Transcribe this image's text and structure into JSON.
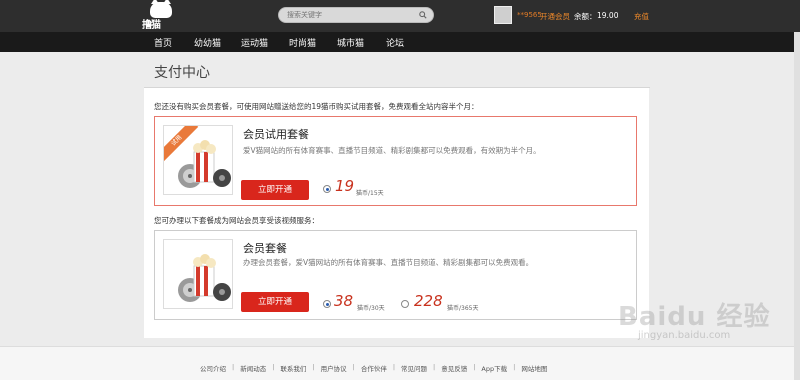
{
  "header": {
    "logo_text": "撸猫",
    "search_placeholder": "搜索关键字",
    "username": "**9565",
    "open_vip_label": "开通会员",
    "balance_label": "余额：",
    "balance_value": "19.00",
    "recharge_label": "充值"
  },
  "nav": {
    "items": [
      {
        "label": "首页"
      },
      {
        "label": "幼幼猫"
      },
      {
        "label": "运动猫"
      },
      {
        "label": "时尚猫"
      },
      {
        "label": "城市猫"
      },
      {
        "label": "论坛"
      }
    ]
  },
  "main": {
    "page_title": "支付中心",
    "trial_note": "您还没有购买会员套餐，可使用网站赠送给您的19猫币购买试用套餐，免费观看全站内容半个月：",
    "trial": {
      "ribbon": "试用",
      "title": "会员试用套餐",
      "desc": "爱V猫网站的所有体育赛事、直播节目频道、精彩剧集都可以免费观看，有效期为半个月。",
      "button": "立即开通",
      "price": "19",
      "unit": "猫币/15天"
    },
    "member_note": "您可办理以下套餐成为网站会员享受该视频服务：",
    "member": {
      "title": "会员套餐",
      "desc": "办理会员套餐，爱V猫网站的所有体育赛事、直播节目频道、精彩剧集都可以免费观看。",
      "button": "立即开通",
      "options": [
        {
          "price": "38",
          "unit": "猫币/30天",
          "selected": true
        },
        {
          "price": "228",
          "unit": "猫币/365天",
          "selected": false
        }
      ]
    }
  },
  "footer": {
    "links": [
      "公司介绍",
      "新闻动态",
      "联系我们",
      "用户协议",
      "合作伙伴",
      "常见问题",
      "意见反馈",
      "App下载",
      "网站地图"
    ]
  },
  "watermark": {
    "text": "Baidu 经验",
    "url": "jingyan.baidu.com"
  },
  "colors": {
    "topbar": "#2e2e2e",
    "navbar": "#1a1a1a",
    "accent_red": "#d9261c",
    "accent_orange": "#f08a2a",
    "price_red": "#c8321e"
  }
}
